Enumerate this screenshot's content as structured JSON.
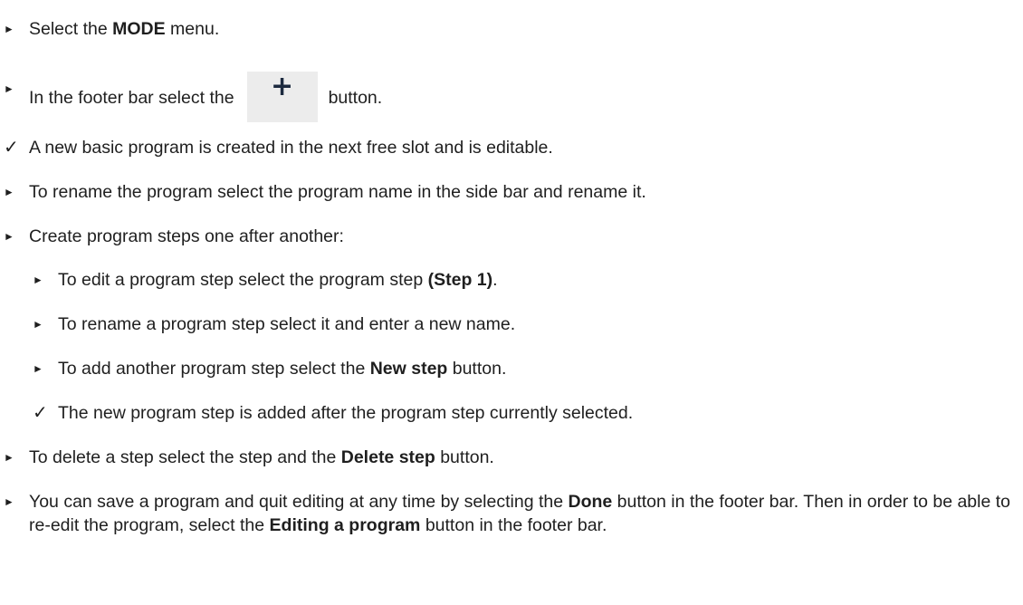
{
  "icons": {
    "action": "arrow-right-triangle-icon",
    "result": "checkmark-icon",
    "add": "plus-icon"
  },
  "plus_glyph": "+",
  "steps": [
    {
      "marker": "►",
      "pre": "Select the ",
      "bold": "MODE",
      "post": " menu."
    },
    {
      "marker": "►",
      "pre": "In the footer bar select the",
      "post": "button."
    },
    {
      "marker": "✓",
      "text": "A new basic program is created in the next free slot and is editable."
    },
    {
      "marker": "►",
      "text": "To rename the program select the program name in the side bar and rename it."
    },
    {
      "marker": "►",
      "text": "Create program steps one after another:"
    },
    {
      "marker": "►",
      "pre": "To edit a program step select the program step ",
      "bold": "(Step 1)",
      "post": "."
    },
    {
      "marker": "►",
      "text": "To rename a program step select it and enter a new name."
    },
    {
      "marker": "►",
      "pre": "To add another program step select the ",
      "bold": "New step",
      "post": " button."
    },
    {
      "marker": "✓",
      "text": "The new program step is added after the program step currently selected."
    },
    {
      "marker": "►",
      "pre": "To delete a step select the step and the ",
      "bold": "Delete step",
      "post": " button."
    },
    {
      "marker": "►",
      "pre": "You can save a program and quit editing at any time by selecting the ",
      "bold": "Done",
      "mid": " button in the footer bar. Then in order to be able to re-edit the program, select the ",
      "bold2": "Editing a program",
      "post": " button in the footer bar."
    }
  ]
}
